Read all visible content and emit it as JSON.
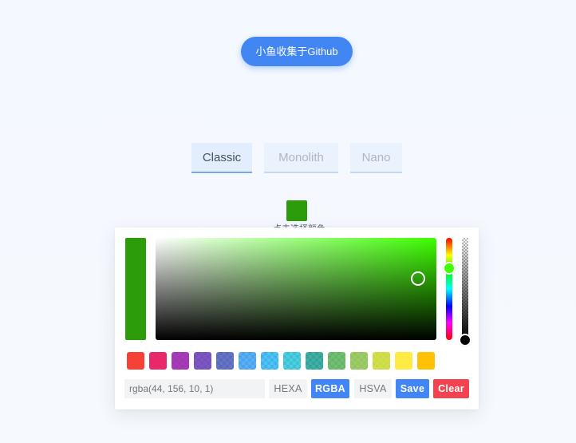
{
  "header": {
    "github_button_label": "小鱼收集于Github"
  },
  "tabs": [
    {
      "label": "Classic",
      "active": true
    },
    {
      "label": "Monolith",
      "active": false
    },
    {
      "label": "Nano",
      "active": false
    }
  ],
  "trigger": {
    "color": "#2c9c0a",
    "label": "点击选择颜色"
  },
  "picker": {
    "current_color": "rgba(44, 156, 10, 1)",
    "hue_degrees": 106,
    "saturation_percent": 94,
    "value_percent": 61,
    "opacity": 1,
    "swatches": [
      {
        "name": "red",
        "color": "rgba(244, 67, 54, 1)"
      },
      {
        "name": "pink",
        "color": "rgba(233, 30, 99, 0.95)"
      },
      {
        "name": "purple",
        "color": "rgba(156, 39, 176, 0.9)"
      },
      {
        "name": "deep-purple",
        "color": "rgba(103, 58, 183, 0.85)"
      },
      {
        "name": "indigo",
        "color": "rgba(63, 81, 181, 0.8)"
      },
      {
        "name": "blue",
        "color": "rgba(33, 150, 243, 0.75)"
      },
      {
        "name": "light-blue",
        "color": "rgba(3, 169, 244, 0.7)"
      },
      {
        "name": "cyan",
        "color": "rgba(0, 188, 212, 0.7)"
      },
      {
        "name": "teal",
        "color": "rgba(0, 150, 136, 0.75)"
      },
      {
        "name": "green",
        "color": "rgba(76, 175, 80, 0.8)"
      },
      {
        "name": "light-green",
        "color": "rgba(139, 195, 74, 0.85)"
      },
      {
        "name": "lime",
        "color": "rgba(205, 220, 57, 0.9)"
      },
      {
        "name": "yellow",
        "color": "rgba(255, 235, 59, 0.95)"
      },
      {
        "name": "amber",
        "color": "rgba(255, 193, 7, 1)"
      }
    ],
    "result_value": "rgba(44, 156, 10, 1)",
    "buttons": {
      "hexa": "HEXA",
      "rgba": "RGBA",
      "hsva": "HSVA",
      "save": "Save",
      "clear": "Clear"
    },
    "active_representation": "RGBA"
  }
}
